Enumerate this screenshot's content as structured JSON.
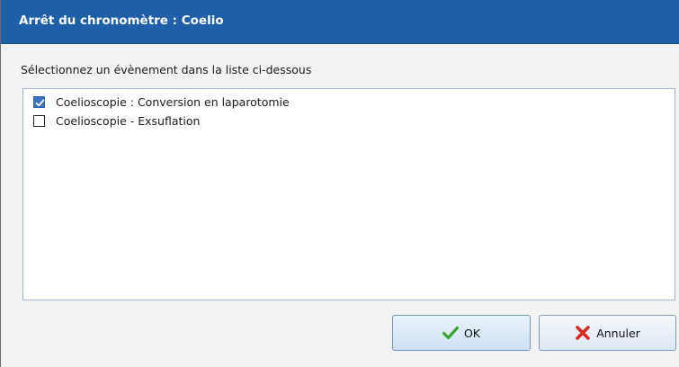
{
  "dialog": {
    "title": "Arrêt du chronomètre : Coelio",
    "instruction": "Sélectionnez un évènement dans la liste ci-dessous",
    "items": [
      {
        "label": "Coelioscopie : Conversion en laparotomie",
        "checked": true
      },
      {
        "label": "Coelioscopie - Exsuflation",
        "checked": false
      }
    ],
    "buttons": {
      "ok_label": "OK",
      "cancel_label": "Annuler"
    },
    "colors": {
      "titlebar": "#1e5fa8",
      "ok_icon": "#3aa62c",
      "cancel_icon": "#d62a1f"
    },
    "icons": {
      "ok": "checkmark-icon",
      "cancel": "red-x-icon"
    }
  }
}
